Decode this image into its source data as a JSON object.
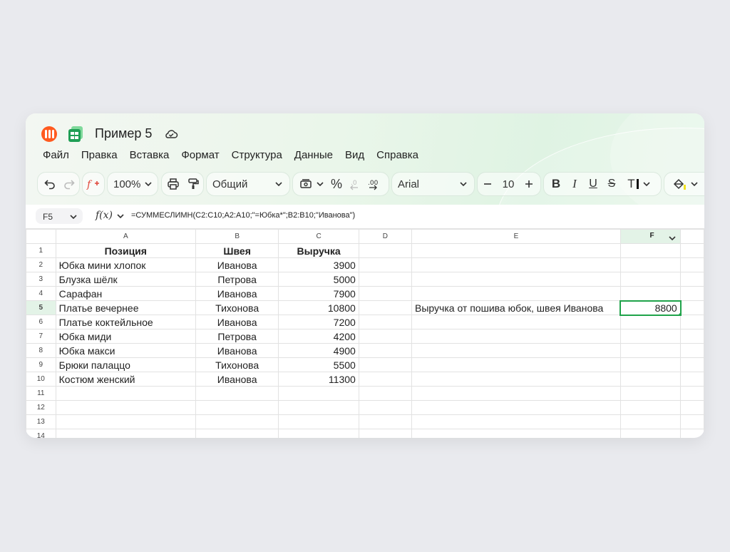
{
  "app": {
    "title": "Пример 5",
    "colors": {
      "accent": "#1fa34a",
      "logo_orange": "#ff5a1f",
      "logo_green": "#1f9e55"
    }
  },
  "menu": [
    "Файл",
    "Правка",
    "Вставка",
    "Формат",
    "Структура",
    "Данные",
    "Вид",
    "Справка"
  ],
  "toolbar": {
    "zoom": "100%",
    "number_format": "Общий",
    "font": "Arial",
    "font_size": "10",
    "percent": "%",
    "bold": "B",
    "italic": "I",
    "underline": "U",
    "strike": "S",
    "text_color": "T"
  },
  "formula_bar": {
    "cell_ref": "F5",
    "fx": "f(x)",
    "formula": "=СУММЕСЛИМН(C2:C10;A2:A10;\"=Юбка*\";B2:B10;\"Иванова\")"
  },
  "sheet": {
    "columns": [
      "A",
      "B",
      "C",
      "D",
      "E",
      "F"
    ],
    "row_numbers": [
      "1",
      "2",
      "3",
      "4",
      "5",
      "6",
      "7",
      "8",
      "9",
      "10",
      "11",
      "12",
      "13",
      "14"
    ],
    "headers": [
      "Позиция",
      "Швея",
      "Выручка"
    ],
    "rows": [
      [
        "Юбка мини хлопок",
        "Иванова",
        "3900"
      ],
      [
        "Блузка шёлк",
        "Петрова",
        "5000"
      ],
      [
        "Сарафан",
        "Иванова",
        "7900"
      ],
      [
        "Платье вечернее",
        "Тихонова",
        "10800"
      ],
      [
        "Платье коктейльное",
        "Иванова",
        "7200"
      ],
      [
        "Юбка миди",
        "Петрова",
        "4200"
      ],
      [
        "Юбка макси",
        "Иванова",
        "4900"
      ],
      [
        "Брюки палаццо",
        "Тихонова",
        "5500"
      ],
      [
        "Костюм женский",
        "Иванова",
        "11300"
      ]
    ],
    "e5": "Выручка от пошива юбок, швея Иванова",
    "f5": "8800"
  }
}
